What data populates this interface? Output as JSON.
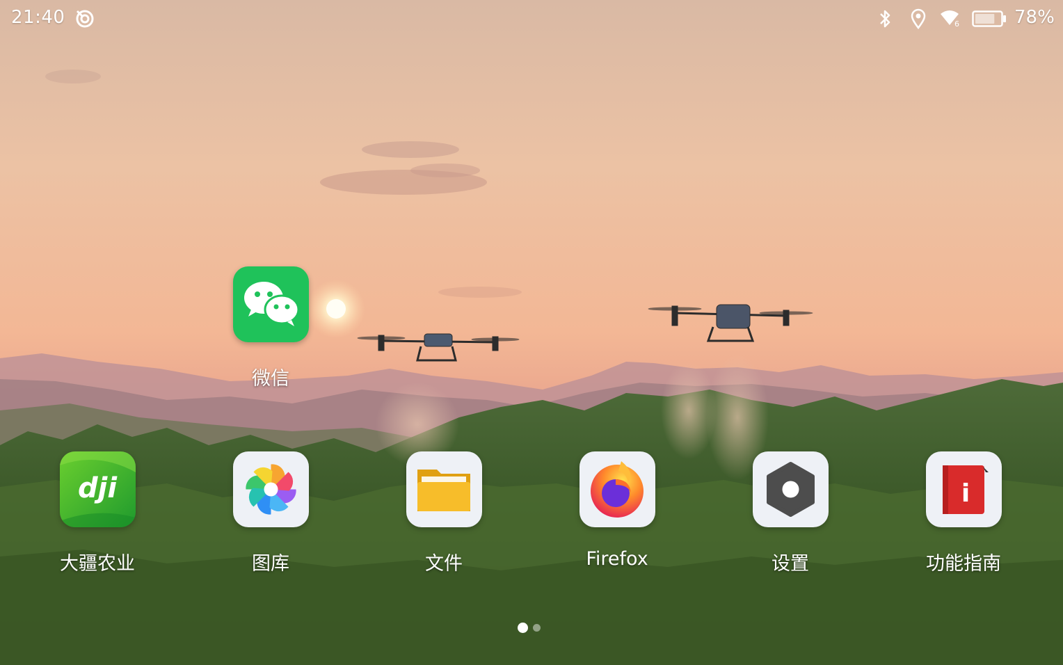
{
  "status_bar": {
    "time": "21:40",
    "battery_percent": "78%",
    "battery_level": 0.78,
    "icons": [
      "hotspot-icon",
      "bluetooth-icon",
      "location-icon",
      "wifi-6-icon",
      "battery-icon"
    ],
    "wifi_badge": "6"
  },
  "apps": {
    "wechat": {
      "label": "微信",
      "icon": "wechat-icon",
      "color": "#1fc25a"
    },
    "dji_agriculture": {
      "label": "大疆农业",
      "icon": "dji-icon",
      "color": "#2fae2f"
    },
    "gallery": {
      "label": "图库",
      "icon": "gallery-icon",
      "color": "#eef1f6"
    },
    "files": {
      "label": "文件",
      "icon": "folder-icon",
      "color": "#f5b51d"
    },
    "firefox": {
      "label": "Firefox",
      "icon": "firefox-icon",
      "color": "#ff7139"
    },
    "settings": {
      "label": "设置",
      "icon": "settings-icon",
      "color": "#555555"
    },
    "guide": {
      "label": "功能指南",
      "icon": "guide-icon",
      "color": "#d92b2b"
    }
  },
  "dji_logo_text": "dji",
  "guide_logo_text": "i",
  "page_indicator": {
    "pages": 2,
    "current": 1
  }
}
